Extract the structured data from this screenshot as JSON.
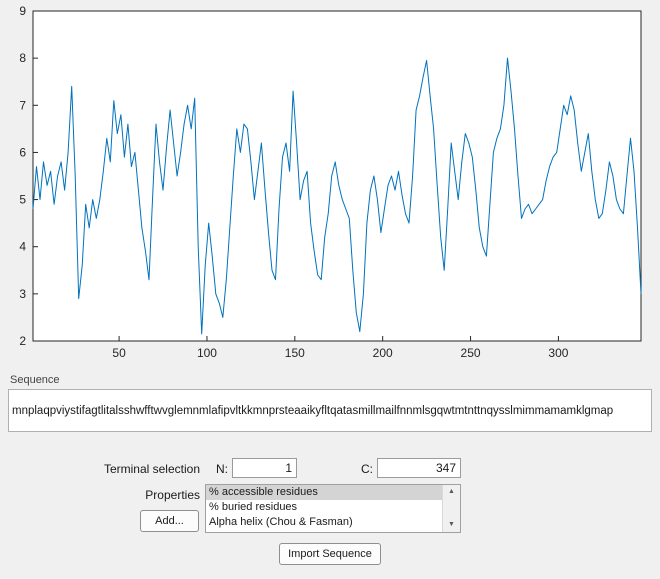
{
  "window": {
    "background": "#f0f0f0"
  },
  "chart_data": {
    "type": "line",
    "title": "",
    "xlabel": "",
    "ylabel": "",
    "xlim": [
      1,
      347
    ],
    "ylim": [
      2,
      9
    ],
    "x_ticks": [
      50,
      100,
      150,
      200,
      250,
      300
    ],
    "y_ticks": [
      2,
      3,
      4,
      5,
      6,
      7,
      8,
      9
    ],
    "grid": false,
    "legend": "none",
    "line_color": "#0072BD",
    "x_start": 1,
    "x_step": 2,
    "values": [
      4.8,
      5.7,
      5.0,
      5.8,
      5.3,
      5.6,
      4.9,
      5.5,
      5.8,
      5.2,
      6.0,
      7.4,
      5.5,
      2.9,
      3.6,
      4.9,
      4.4,
      5.0,
      4.6,
      5.0,
      5.6,
      6.3,
      5.8,
      7.1,
      6.4,
      6.8,
      5.9,
      6.6,
      5.7,
      6.0,
      5.2,
      4.4,
      3.9,
      3.3,
      5.0,
      6.6,
      5.8,
      5.2,
      6.1,
      6.9,
      6.2,
      5.5,
      6.0,
      6.6,
      7.0,
      6.5,
      7.15,
      4.0,
      2.15,
      3.6,
      4.5,
      3.8,
      3.0,
      2.8,
      2.5,
      3.3,
      4.4,
      5.5,
      6.5,
      6.0,
      6.6,
      6.5,
      5.8,
      5.0,
      5.6,
      6.2,
      5.2,
      4.3,
      3.5,
      3.3,
      4.8,
      5.9,
      6.2,
      5.6,
      7.3,
      6.2,
      5.0,
      5.4,
      5.6,
      4.5,
      3.9,
      3.4,
      3.3,
      4.2,
      4.7,
      5.5,
      5.8,
      5.3,
      5.0,
      4.8,
      4.6,
      3.5,
      2.6,
      2.2,
      3.0,
      4.5,
      5.2,
      5.5,
      5.0,
      4.3,
      4.8,
      5.3,
      5.5,
      5.2,
      5.6,
      5.1,
      4.7,
      4.5,
      5.5,
      6.9,
      7.2,
      7.6,
      7.95,
      7.2,
      6.5,
      5.3,
      4.2,
      3.5,
      4.8,
      6.2,
      5.6,
      5.0,
      5.8,
      6.4,
      6.2,
      5.9,
      5.2,
      4.4,
      4.0,
      3.8,
      4.9,
      6.0,
      6.3,
      6.5,
      7.0,
      8.0,
      7.3,
      6.5,
      5.5,
      4.6,
      4.8,
      4.9,
      4.7,
      4.8,
      4.9,
      5.0,
      5.4,
      5.7,
      5.9,
      6.0,
      6.5,
      7.0,
      6.8,
      7.2,
      6.9,
      6.2,
      5.6,
      6.0,
      6.4,
      5.6,
      5.0,
      4.6,
      4.7,
      5.2,
      5.8,
      5.5,
      5.0,
      4.8,
      4.7,
      5.5,
      6.3,
      5.6,
      4.4,
      3.0
    ]
  },
  "sequence": {
    "label": "Sequence",
    "value": "mnplaqpviystifagtlitalsshwfftwvglemnmlafipvltkkmnprsteaaikyfltqatasmillmailfnnmlsgqwtmtnttnqysslmimmamamklgmap"
  },
  "terminal": {
    "label": "Terminal selection",
    "n_label": "N:",
    "n_value": "1",
    "c_label": "C:",
    "c_value": "347"
  },
  "properties": {
    "label": "Properties",
    "add_button": "Add...",
    "items": [
      {
        "label": "% accessible residues",
        "selected": true
      },
      {
        "label": "% buried residues",
        "selected": false
      },
      {
        "label": "Alpha helix (Chou & Fasman)",
        "selected": false
      }
    ]
  },
  "actions": {
    "import_button": "Import Sequence"
  }
}
